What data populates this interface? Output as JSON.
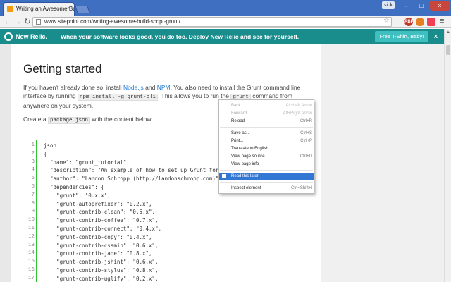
{
  "browser": {
    "tab_title": "Writing an Awesome Buil",
    "tab_close": "×",
    "user_badge": "sick",
    "min_glyph": "–",
    "max_glyph": "□",
    "close_glyph": "×",
    "back_glyph": "←",
    "forward_glyph": "→",
    "reload_glyph": "↻",
    "url": "www.sitepoint.com/writing-awesome-build-script-grunt/",
    "star_glyph": "☆",
    "menu_glyph": "≡",
    "extensions": [
      {
        "name": "adblock-icon",
        "label": "ABP"
      },
      {
        "name": "flame-icon",
        "label": ""
      },
      {
        "name": "pocket-icon",
        "label": ""
      }
    ]
  },
  "banner": {
    "brand": "New Relic.",
    "message": "When your software looks good, you do too. Deploy New Relic and see for yourself.",
    "cta": "Free T-Shirt, Baby!",
    "close": "x"
  },
  "article": {
    "heading": "Getting started",
    "p1_a": "If you haven't already done so, install ",
    "p1_link1": "Node.js",
    "p1_b": " and ",
    "p1_link2": "NPM",
    "p1_c": ". You also need to install the Grunt command line interface by running ",
    "p1_code1": "npm install -g grunt-cli",
    "p1_d": ". This allows you to run the ",
    "p1_code2": "grunt",
    "p1_e": " command from anywhere on your system.",
    "p2_a": "Create a ",
    "p2_code": "package.json",
    "p2_b": " with the content below."
  },
  "code": {
    "line_numbers": [
      "1",
      "2",
      "3",
      "4",
      "5",
      "6",
      "7",
      "8",
      "9",
      "10",
      "11",
      "12",
      "13",
      "14",
      "15",
      "16",
      "17"
    ],
    "lines": [
      "json",
      "{",
      "  \"name\": \"grunt_tutorial\",",
      "  \"description\": \"An example of how to set up Grunt for",
      "  \"author\": \"Landon Schropp (http://landonschropp.com)\",",
      "  \"dependencies\": {",
      "    \"grunt\": \"0.x.x\",",
      "    \"grunt-autoprefixer\": \"0.2.x\",",
      "    \"grunt-contrib-clean\": \"0.5.x\",",
      "    \"grunt-contrib-coffee\": \"0.7.x\",",
      "    \"grunt-contrib-connect\": \"0.4.x\",",
      "    \"grunt-contrib-copy\": \"0.4.x\",",
      "    \"grunt-contrib-cssmin\": \"0.6.x\",",
      "    \"grunt-contrib-jade\": \"0.8.x\",",
      "    \"grunt-contrib-jshint\": \"0.6.x\",",
      "    \"grunt-contrib-stylus\": \"0.8.x\",",
      "    \"grunt-contrib-uglify\": \"0.2.x\","
    ]
  },
  "context_menu": {
    "items": [
      {
        "label": "Back",
        "shortcut": "Alt+Left Arrow",
        "disabled": true
      },
      {
        "label": "Forward",
        "shortcut": "Alt+Right Arrow",
        "disabled": true
      },
      {
        "label": "Reload",
        "shortcut": "Ctrl+R",
        "disabled": false
      },
      {
        "label": "Save as...",
        "shortcut": "Ctrl+S",
        "disabled": false
      },
      {
        "label": "Print...",
        "shortcut": "Ctrl+P",
        "disabled": false
      },
      {
        "label": "Translate to English",
        "shortcut": "",
        "disabled": false
      },
      {
        "label": "View page source",
        "shortcut": "Ctrl+U",
        "disabled": false
      },
      {
        "label": "View page info",
        "shortcut": "",
        "disabled": false
      },
      {
        "label": "Read this later",
        "shortcut": "",
        "disabled": false,
        "highlighted": true
      },
      {
        "label": "Inspect element",
        "shortcut": "Ctrl+Shift+I",
        "disabled": false
      }
    ]
  }
}
